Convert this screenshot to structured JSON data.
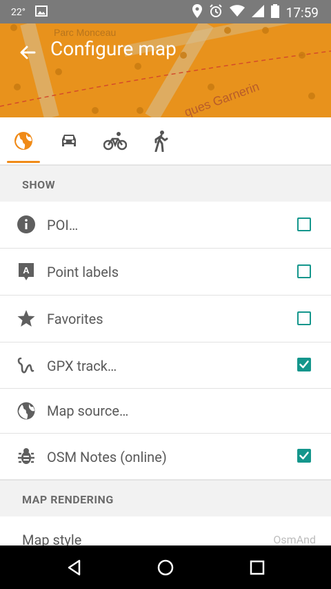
{
  "status_bar": {
    "temperature": "22°",
    "time": "17:59"
  },
  "app_bar": {
    "title": "Configure map",
    "map_labels": [
      "Parc Monceau",
      "ques Garnerin"
    ]
  },
  "profile_tabs": [
    {
      "name": "browse-map",
      "active": true
    },
    {
      "name": "car",
      "active": false
    },
    {
      "name": "bicycle",
      "active": false
    },
    {
      "name": "pedestrian",
      "active": false
    }
  ],
  "sections": {
    "show": "SHOW",
    "map_rendering": "MAP RENDERING"
  },
  "show_items": [
    {
      "label": "POI…",
      "checked": false
    },
    {
      "label": "Point labels",
      "checked": false
    },
    {
      "label": "Favorites",
      "checked": false
    },
    {
      "label": "GPX track…",
      "checked": true
    },
    {
      "label": "Map source…"
    },
    {
      "label": "OSM Notes (online)",
      "checked": true
    }
  ],
  "map_rendering_items": [
    {
      "label": "Map style",
      "value": "OsmAnd"
    }
  ],
  "colors": {
    "accent": "#f08a17",
    "checkbox": "#14968c"
  }
}
